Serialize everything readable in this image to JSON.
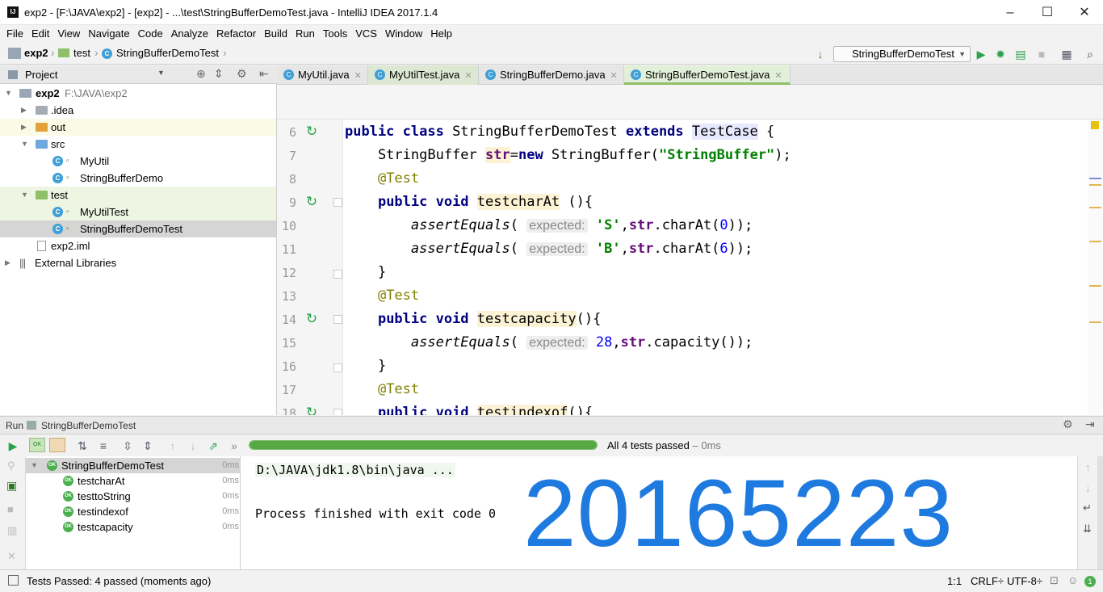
{
  "window": {
    "title": "exp2 - [F:\\JAVA\\exp2] - [exp2] - ...\\test\\StringBufferDemoTest.java - IntelliJ IDEA 2017.1.4",
    "app_icon": "IJ",
    "minimize": "–",
    "maximize": "☐",
    "close": "✕"
  },
  "menu": [
    "File",
    "Edit",
    "View",
    "Navigate",
    "Code",
    "Analyze",
    "Refactor",
    "Build",
    "Run",
    "Tools",
    "VCS",
    "Window",
    "Help"
  ],
  "nav": {
    "crumbs": [
      "exp2",
      "test",
      "StringBufferDemoTest"
    ],
    "run_config": "StringBufferDemoTest"
  },
  "project": {
    "header": "Project",
    "tree": [
      {
        "label": "exp2",
        "extra": "F:\\JAVA\\exp2",
        "level": 0,
        "kind": "module",
        "expanded": true
      },
      {
        "label": ".idea",
        "level": 1,
        "kind": "folder",
        "expanded": false
      },
      {
        "label": "out",
        "level": 1,
        "kind": "folder-orange",
        "expanded": false
      },
      {
        "label": "src",
        "level": 1,
        "kind": "folder-blue",
        "expanded": true
      },
      {
        "label": "MyUtil",
        "level": 2,
        "kind": "class"
      },
      {
        "label": "StringBufferDemo",
        "level": 2,
        "kind": "class"
      },
      {
        "label": "test",
        "level": 1,
        "kind": "folder-green",
        "expanded": true
      },
      {
        "label": "MyUtilTest",
        "level": 2,
        "kind": "class"
      },
      {
        "label": "StringBufferDemoTest",
        "level": 2,
        "kind": "class",
        "selected": true
      },
      {
        "label": "exp2.iml",
        "level": 1,
        "kind": "file"
      },
      {
        "label": "External Libraries",
        "level": 0,
        "kind": "lib",
        "expanded": false
      }
    ]
  },
  "tabs": [
    {
      "label": "MyUtil.java",
      "active": false
    },
    {
      "label": "MyUtilTest.java",
      "active": false
    },
    {
      "label": "StringBufferDemo.java",
      "active": false
    },
    {
      "label": "StringBufferDemoTest.java",
      "active": true
    }
  ],
  "editor": {
    "line_numbers": [
      "6",
      "7",
      "8",
      "9",
      "10",
      "11",
      "12",
      "13",
      "14",
      "15",
      "16",
      "17",
      "18"
    ]
  },
  "run": {
    "header_label": "Run",
    "header_config": "StringBufferDemoTest",
    "status": "All 4 tests passed",
    "duration": " – 0ms",
    "progress": 1.0,
    "tests": [
      {
        "name": "StringBufferDemoTest",
        "time": "0ms",
        "root": true
      },
      {
        "name": "testcharAt",
        "time": "0ms"
      },
      {
        "name": "testtoString",
        "time": "0ms"
      },
      {
        "name": "testindexof",
        "time": "0ms"
      },
      {
        "name": "testcapacity",
        "time": "0ms"
      }
    ],
    "console_cmd": "D:\\JAVA\\jdk1.8\\bin\\java ...",
    "console_exit": "Process finished with exit code 0",
    "watermark": "20165223"
  },
  "status_bar": {
    "message": "Tests Passed: 4 passed (moments ago)",
    "position": "1:1",
    "line_sep": "CRLF÷",
    "encoding": "UTF-8÷",
    "events": "1"
  },
  "colors": {
    "accent": "#3f9fd6",
    "pass": "#58a745",
    "watermark": "#1f7ae0"
  }
}
